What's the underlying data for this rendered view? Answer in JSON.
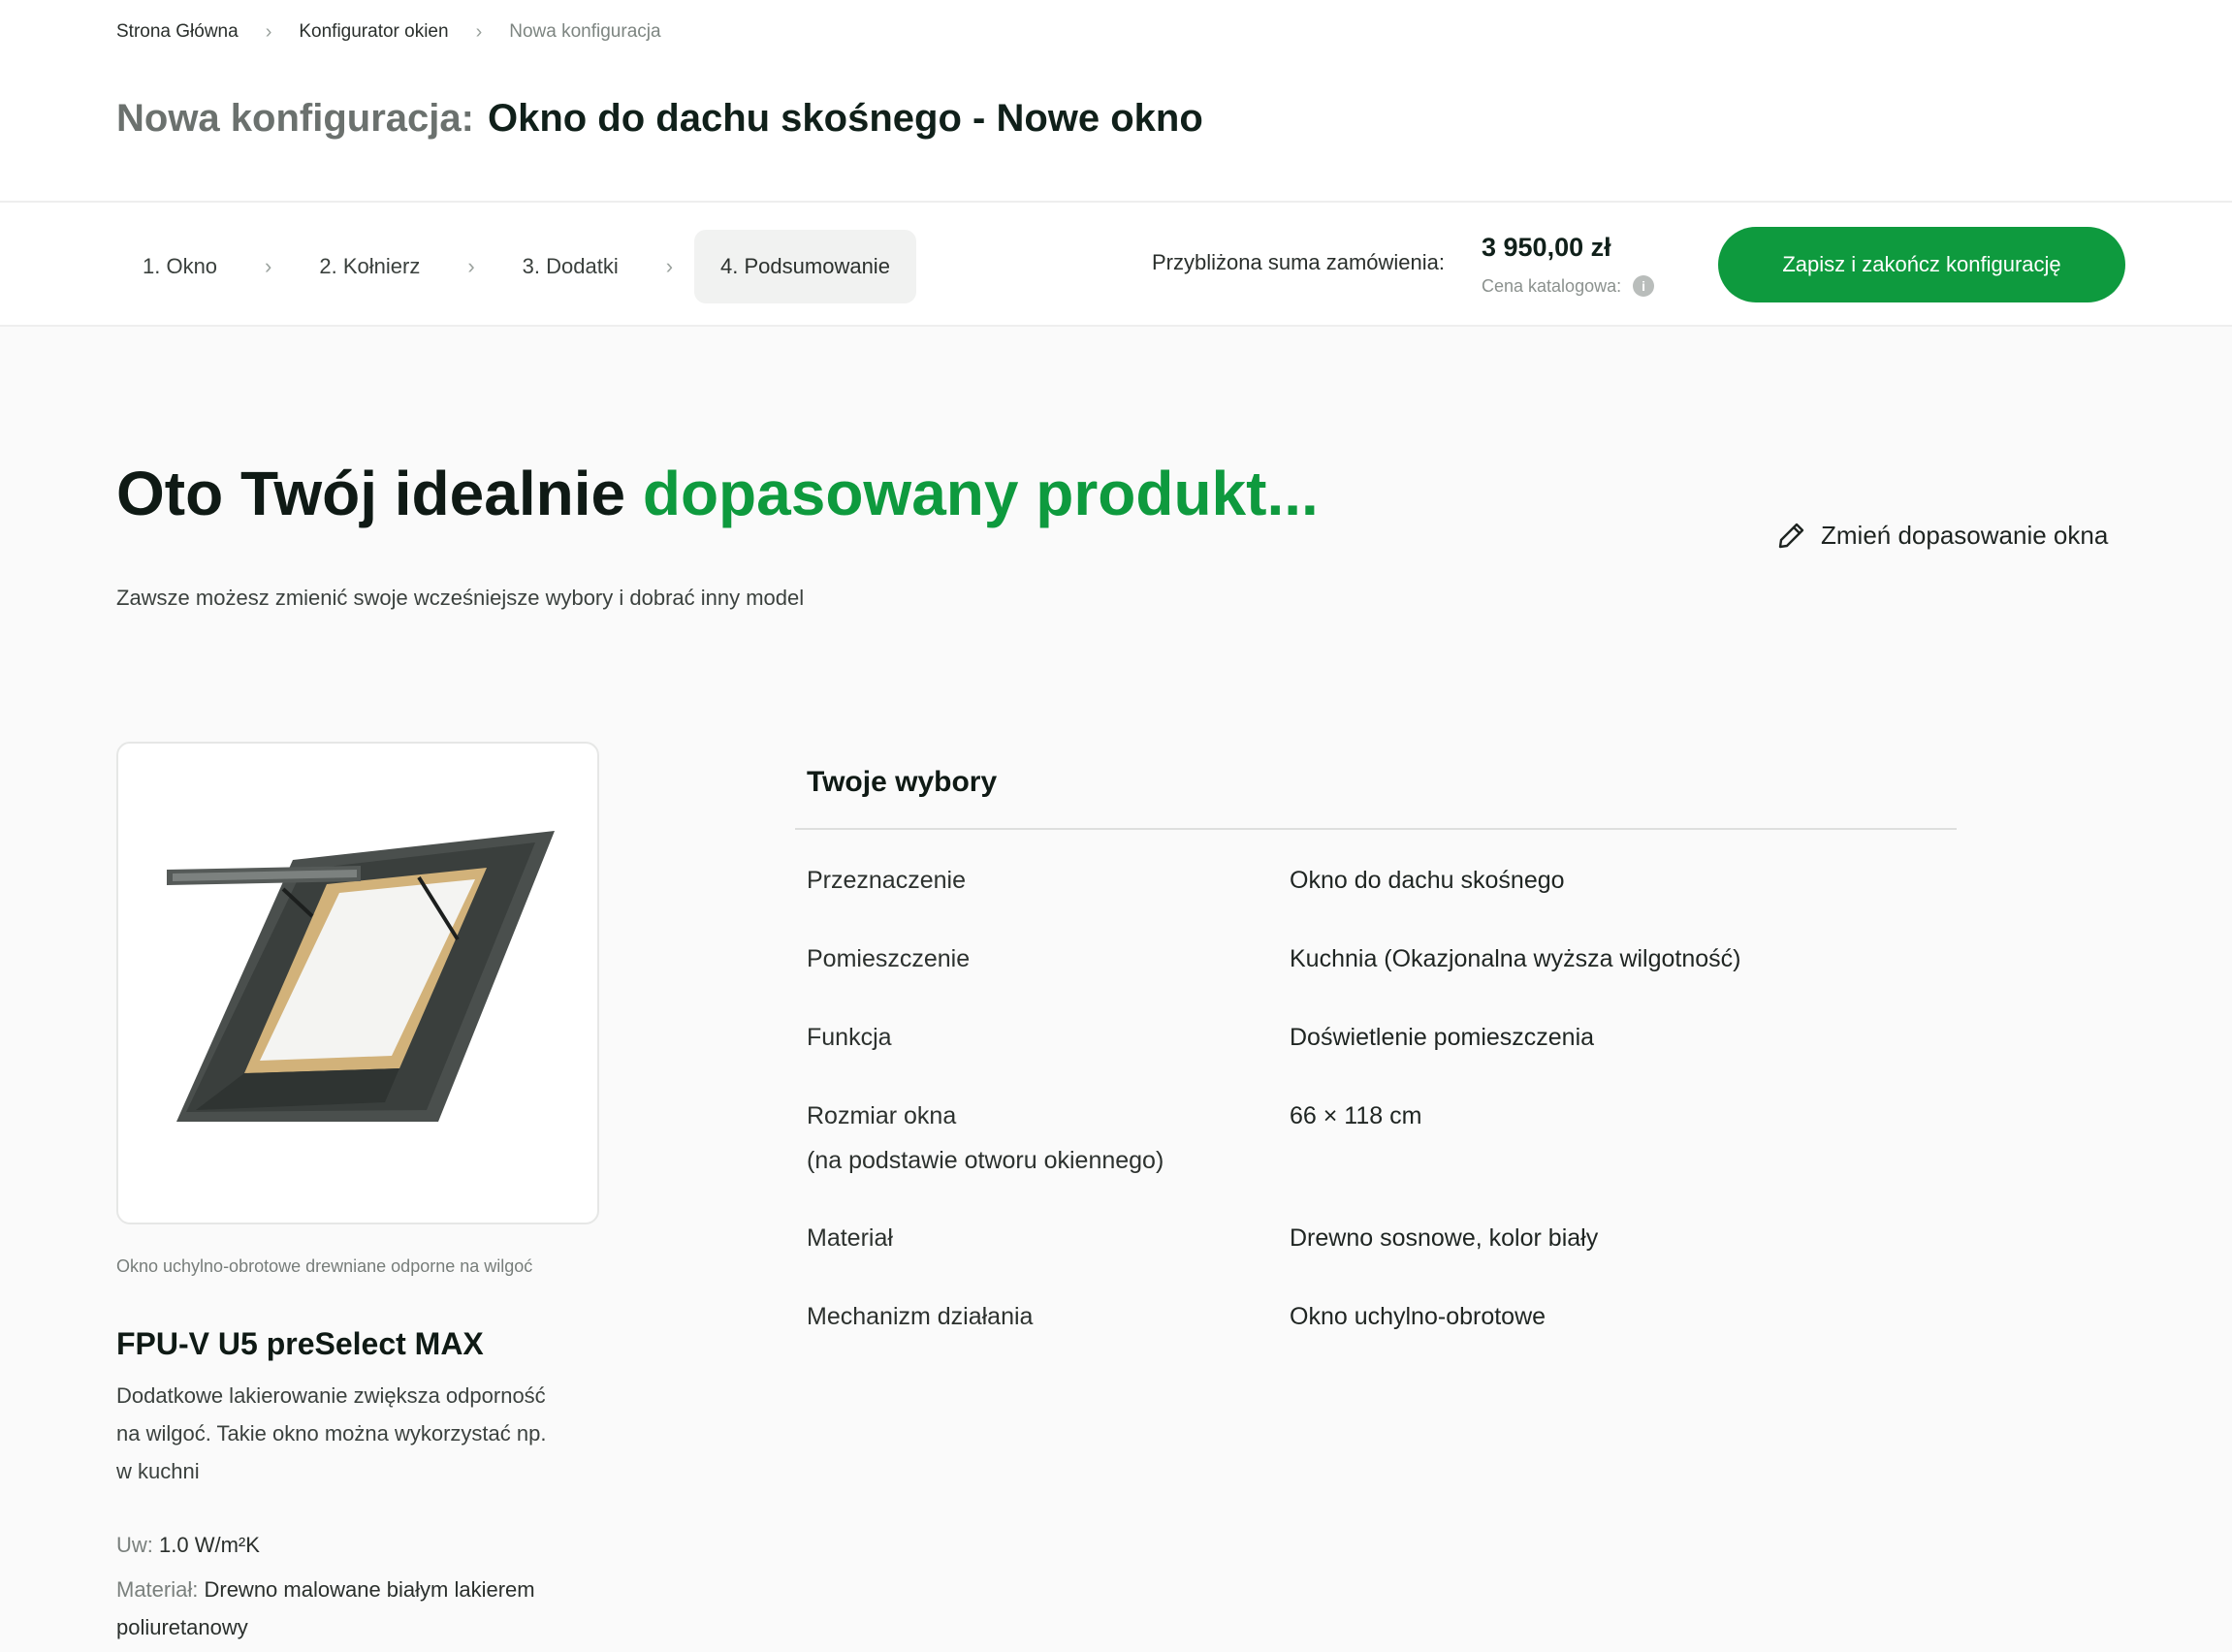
{
  "breadcrumb": {
    "items": [
      "Strona Główna",
      "Konfigurator okien",
      "Nowa konfiguracja"
    ]
  },
  "page_title": {
    "prefix": "Nowa konfiguracja:",
    "name": "Okno do dachu skośnego - Nowe okno"
  },
  "steps": [
    {
      "label": "1. Okno"
    },
    {
      "label": "2. Kołnierz"
    },
    {
      "label": "3. Dodatki"
    },
    {
      "label": "4. Podsumowanie",
      "active": true
    }
  ],
  "order": {
    "sum_label": "Przybliżona suma zamówienia:",
    "sum_value": "3 950,00 zł",
    "catalog_label": "Cena katalogowa:",
    "save_label": "Zapisz i zakończ konfigurację"
  },
  "hero": {
    "title_plain": "Oto Twój idealnie",
    "title_accent": "dopasowany produkt...",
    "subtitle": "Zawsze możesz zmienić swoje wcześniejsze wybory i dobrać inny model",
    "change_link": "Zmień dopasowanie okna"
  },
  "product": {
    "caption": "Okno uchylno-obrotowe drewniane odporne na wilgoć",
    "name": "FPU-V U5 preSelect MAX",
    "description": "Dodatkowe lakierowanie zwiększa odporność na wilgoć. Takie okno można wykorzystać np. w kuchni",
    "specs": {
      "uw_key": "Uw:",
      "uw_value": "1.0 W/m²K",
      "material_key": "Materiał:",
      "material_value": "Drewno malowane białym lakierem poliuretanowy"
    }
  },
  "choices": {
    "title": "Twoje wybory",
    "rows": [
      {
        "label": "Przeznaczenie",
        "value": "Okno do dachu skośnego"
      },
      {
        "label": "Pomieszczenie",
        "value": "Kuchnia (Okazjonalna wyższa wilgotność)"
      },
      {
        "label": "Funkcja",
        "value": "Doświetlenie pomieszczenia"
      },
      {
        "label": "Rozmiar okna",
        "sublabel": "(na podstawie otworu okiennego)",
        "value": "66 × 118 cm"
      },
      {
        "label": "Materiał",
        "value": "Drewno sosnowe, kolor biały"
      },
      {
        "label": "Mechanizm działania",
        "value": "Okno uchylno-obrotowe"
      }
    ]
  },
  "colors": {
    "accent": "#0e9a3e",
    "text": "#111b17",
    "muted": "#7d8581"
  },
  "icons": {
    "breadcrumb_sep": "chevron-right-icon",
    "info": "info-icon",
    "edit": "pencil-icon"
  }
}
